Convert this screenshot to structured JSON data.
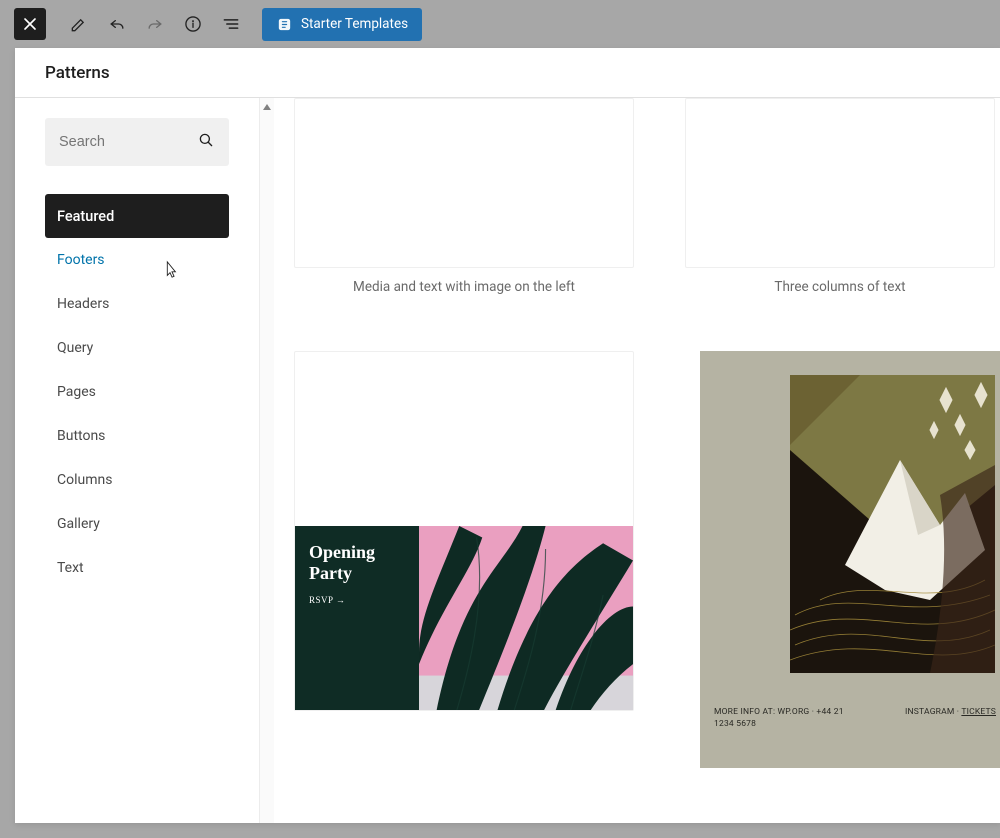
{
  "toolbar": {
    "starter_label": "Starter Templates"
  },
  "panel": {
    "title": "Patterns"
  },
  "search": {
    "placeholder": "Search"
  },
  "categories": [
    {
      "label": "Featured",
      "state": "active"
    },
    {
      "label": "Footers",
      "state": "hover"
    },
    {
      "label": "Headers",
      "state": ""
    },
    {
      "label": "Query",
      "state": ""
    },
    {
      "label": "Pages",
      "state": ""
    },
    {
      "label": "Buttons",
      "state": ""
    },
    {
      "label": "Columns",
      "state": ""
    },
    {
      "label": "Gallery",
      "state": ""
    },
    {
      "label": "Text",
      "state": ""
    }
  ],
  "previews": {
    "p1_caption": "Media and text with image on the left",
    "p2_caption": "Three columns of text",
    "party_title_line1": "Opening",
    "party_title_line2": "Party",
    "party_sub": "RSVP →",
    "art_info_left": "MORE INFO AT: WP.ORG · +44 21 1234 5678",
    "art_info_right_a": "INSTAGRAM",
    "art_info_right_sep": " · ",
    "art_info_right_b": "TICKETS"
  }
}
